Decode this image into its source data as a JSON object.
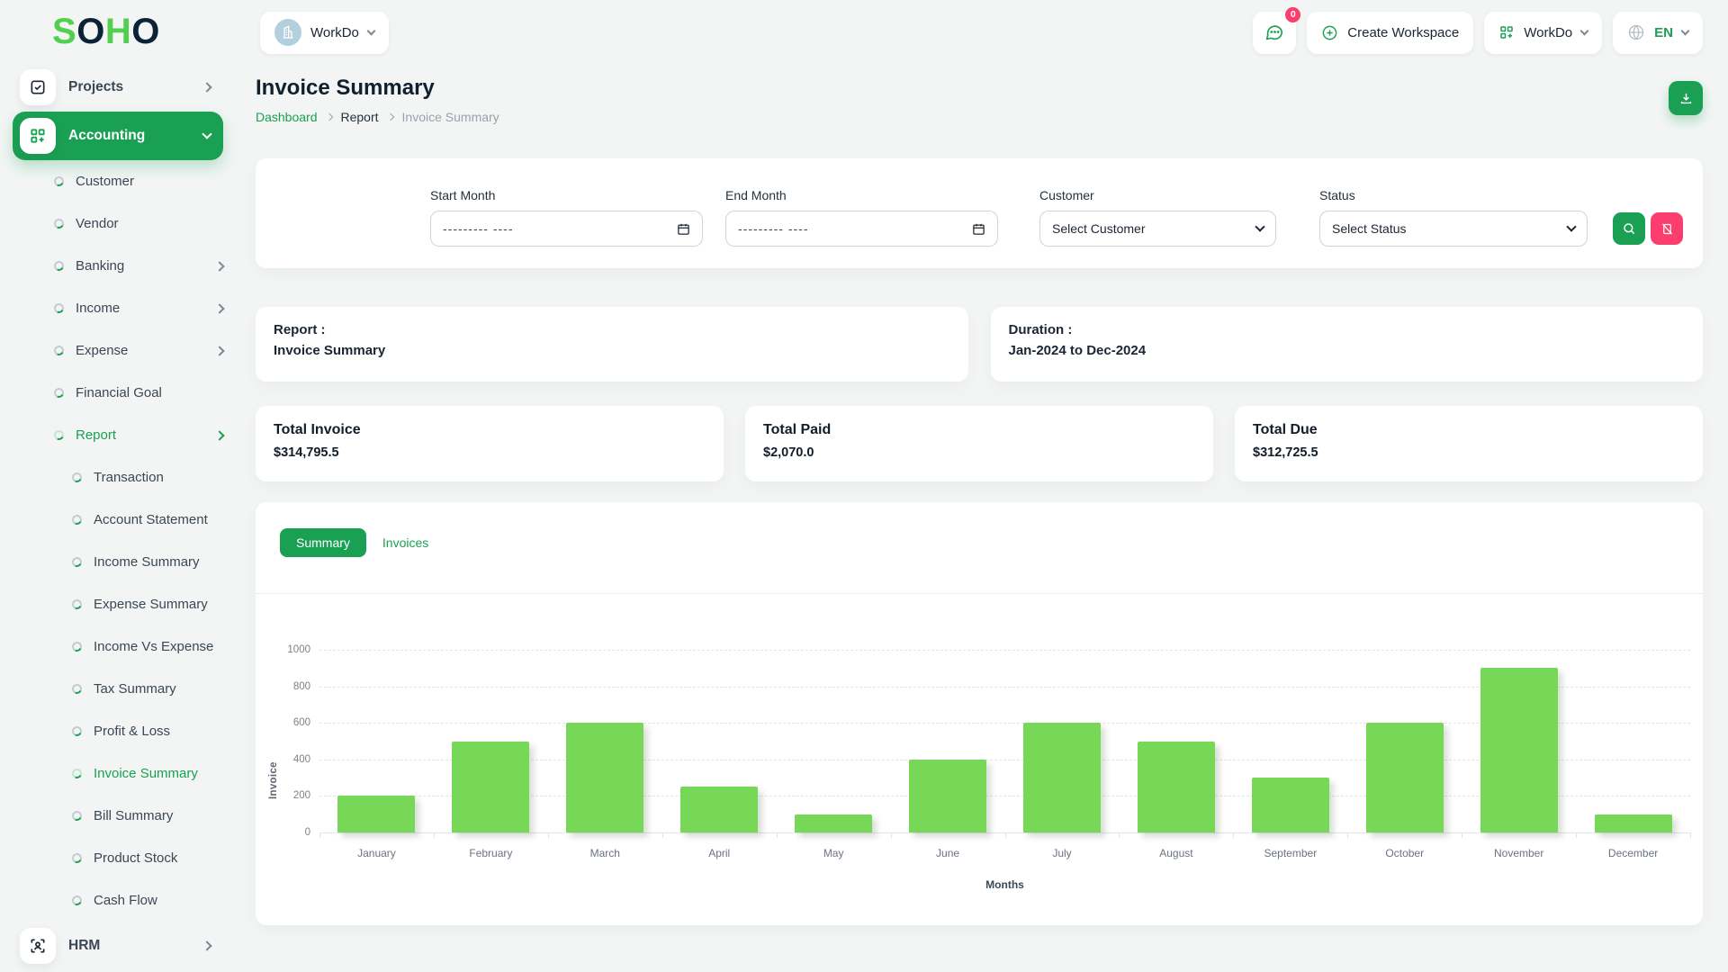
{
  "colors": {
    "primary": "#1aa053",
    "danger": "#fb3e6e",
    "bar_green": "#77d858",
    "logo_green": "#52cf4f",
    "logo_dark": "#0b2239"
  },
  "logo": {
    "letters": [
      {
        "ch": "S",
        "tone": "green"
      },
      {
        "ch": "O",
        "tone": "dark"
      },
      {
        "ch": "H",
        "tone": "green"
      },
      {
        "ch": "O",
        "tone": "dark"
      }
    ]
  },
  "header": {
    "workspace_label": "WorkDo",
    "chat_badge": "0",
    "create_workspace_label": "Create Workspace",
    "workdo_label": "WorkDo",
    "language": "EN"
  },
  "sidebar": {
    "items": [
      {
        "label": "Projects",
        "icon": "projects-icon",
        "level": 0,
        "chevron": "right",
        "active": false
      },
      {
        "label": "Accounting",
        "icon": "accounting-icon",
        "level": 0,
        "chevron": "down",
        "active": true
      },
      {
        "label": "Customer",
        "level": 1
      },
      {
        "label": "Vendor",
        "level": 1
      },
      {
        "label": "Banking",
        "level": 1,
        "chevron": "right"
      },
      {
        "label": "Income",
        "level": 1,
        "chevron": "right"
      },
      {
        "label": "Expense",
        "level": 1,
        "chevron": "right"
      },
      {
        "label": "Financial Goal",
        "level": 1
      },
      {
        "label": "Report",
        "level": 1,
        "chevron": "right",
        "highlight": true
      },
      {
        "label": "Transaction",
        "level": 2
      },
      {
        "label": "Account Statement",
        "level": 2
      },
      {
        "label": "Income Summary",
        "level": 2
      },
      {
        "label": "Expense Summary",
        "level": 2
      },
      {
        "label": "Income Vs Expense",
        "level": 2
      },
      {
        "label": "Tax Summary",
        "level": 2
      },
      {
        "label": "Profit & Loss",
        "level": 2
      },
      {
        "label": "Invoice Summary",
        "level": 2,
        "highlight": true
      },
      {
        "label": "Bill Summary",
        "level": 2
      },
      {
        "label": "Product Stock",
        "level": 2
      },
      {
        "label": "Cash Flow",
        "level": 2
      },
      {
        "label": "HRM",
        "icon": "hrm-icon",
        "level": 0,
        "chevron": "right"
      }
    ]
  },
  "page": {
    "title": "Invoice Summary",
    "breadcrumb": [
      {
        "label": "Dashboard",
        "type": "link"
      },
      {
        "label": "Report",
        "type": "mid"
      },
      {
        "label": "Invoice Summary",
        "type": "current"
      }
    ]
  },
  "filters": {
    "start_month_label": "Start Month",
    "end_month_label": "End Month",
    "month_placeholder": "--------- ----",
    "customer_label": "Customer",
    "customer_value": "Select Customer",
    "status_label": "Status",
    "status_value": "Select Status"
  },
  "report_info": {
    "report_label": "Report :",
    "report_value": "Invoice Summary",
    "duration_label": "Duration :",
    "duration_value": "Jan-2024 to Dec-2024"
  },
  "totals": [
    {
      "label": "Total Invoice",
      "value": "$314,795.5"
    },
    {
      "label": "Total Paid",
      "value": "$2,070.0"
    },
    {
      "label": "Total Due",
      "value": "$312,725.5"
    }
  ],
  "tabs": [
    {
      "label": "Summary",
      "active": true
    },
    {
      "label": "Invoices",
      "active": false
    }
  ],
  "chart_data": {
    "type": "bar",
    "title": "",
    "categories": [
      "January",
      "February",
      "March",
      "April",
      "May",
      "June",
      "July",
      "August",
      "September",
      "October",
      "November",
      "December"
    ],
    "values": [
      200,
      500,
      600,
      250,
      100,
      400,
      600,
      500,
      300,
      600,
      900,
      100
    ],
    "xlabel": "Months",
    "ylabel": "Invoice",
    "ylim": [
      0,
      1000
    ],
    "ytick_step": 200,
    "grid": true,
    "grid_style": "dashed",
    "legend": "none",
    "bar_color": "#77d858"
  }
}
